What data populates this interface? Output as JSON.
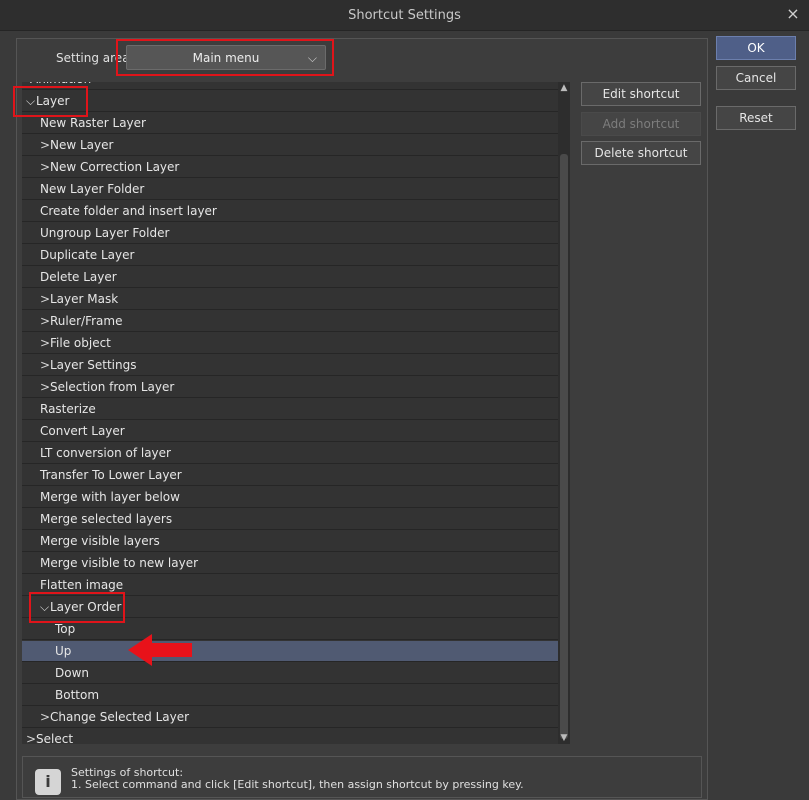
{
  "window": {
    "title": "Shortcut Settings",
    "close_glyph": "×"
  },
  "setting_area": {
    "label": "Setting area:",
    "value": "Main menu",
    "chevron": "⌵"
  },
  "list": {
    "partial_top": "Animation",
    "rows": [
      {
        "label": "Layer",
        "indent": 0,
        "expander": "⌵",
        "selected": false
      },
      {
        "label": "New Raster Layer",
        "indent": 1,
        "expander": "",
        "selected": false
      },
      {
        "label": "New Layer",
        "indent": 1,
        "expander": ">",
        "selected": false
      },
      {
        "label": "New Correction Layer",
        "indent": 1,
        "expander": ">",
        "selected": false
      },
      {
        "label": "New Layer Folder",
        "indent": 1,
        "expander": "",
        "selected": false
      },
      {
        "label": "Create folder and insert layer",
        "indent": 1,
        "expander": "",
        "selected": false
      },
      {
        "label": "Ungroup Layer Folder",
        "indent": 1,
        "expander": "",
        "selected": false
      },
      {
        "label": "Duplicate Layer",
        "indent": 1,
        "expander": "",
        "selected": false
      },
      {
        "label": "Delete Layer",
        "indent": 1,
        "expander": "",
        "selected": false
      },
      {
        "label": "Layer Mask",
        "indent": 1,
        "expander": ">",
        "selected": false
      },
      {
        "label": "Ruler/Frame",
        "indent": 1,
        "expander": ">",
        "selected": false
      },
      {
        "label": "File object",
        "indent": 1,
        "expander": ">",
        "selected": false
      },
      {
        "label": "Layer Settings",
        "indent": 1,
        "expander": ">",
        "selected": false
      },
      {
        "label": "Selection from Layer",
        "indent": 1,
        "expander": ">",
        "selected": false
      },
      {
        "label": "Rasterize",
        "indent": 1,
        "expander": "",
        "selected": false
      },
      {
        "label": "Convert Layer",
        "indent": 1,
        "expander": "",
        "selected": false
      },
      {
        "label": "LT conversion of layer",
        "indent": 1,
        "expander": "",
        "selected": false
      },
      {
        "label": "Transfer To Lower Layer",
        "indent": 1,
        "expander": "",
        "selected": false
      },
      {
        "label": "Merge with layer below",
        "indent": 1,
        "expander": "",
        "selected": false
      },
      {
        "label": "Merge selected layers",
        "indent": 1,
        "expander": "",
        "selected": false
      },
      {
        "label": "Merge visible layers",
        "indent": 1,
        "expander": "",
        "selected": false
      },
      {
        "label": "Merge visible to new layer",
        "indent": 1,
        "expander": "",
        "selected": false
      },
      {
        "label": "Flatten image",
        "indent": 1,
        "expander": "",
        "selected": false
      },
      {
        "label": "Layer Order",
        "indent": 1,
        "expander": "⌵",
        "selected": false
      },
      {
        "label": "Top",
        "indent": 2,
        "expander": "",
        "selected": false
      },
      {
        "label": "Up",
        "indent": 2,
        "expander": "",
        "selected": true
      },
      {
        "label": "Down",
        "indent": 2,
        "expander": "",
        "selected": false
      },
      {
        "label": "Bottom",
        "indent": 2,
        "expander": "",
        "selected": false
      },
      {
        "label": "Change Selected Layer",
        "indent": 1,
        "expander": ">",
        "selected": false
      },
      {
        "label": "Select",
        "indent": 0,
        "expander": ">",
        "selected": false
      }
    ]
  },
  "actions": {
    "edit_shortcut": "Edit shortcut",
    "add_shortcut": "Add shortcut",
    "delete_shortcut": "Delete shortcut"
  },
  "dialog_buttons": {
    "ok": "OK",
    "cancel": "Cancel",
    "reset": "Reset"
  },
  "info": {
    "icon": "i",
    "title": "Settings of shortcut:",
    "step1": "1. Select command and click [Edit shortcut], then assign shortcut by pressing key."
  },
  "colors": {
    "selected_row": "#505a72",
    "annotation_red": "#e0141a",
    "ok_button": "#4f5f88"
  }
}
